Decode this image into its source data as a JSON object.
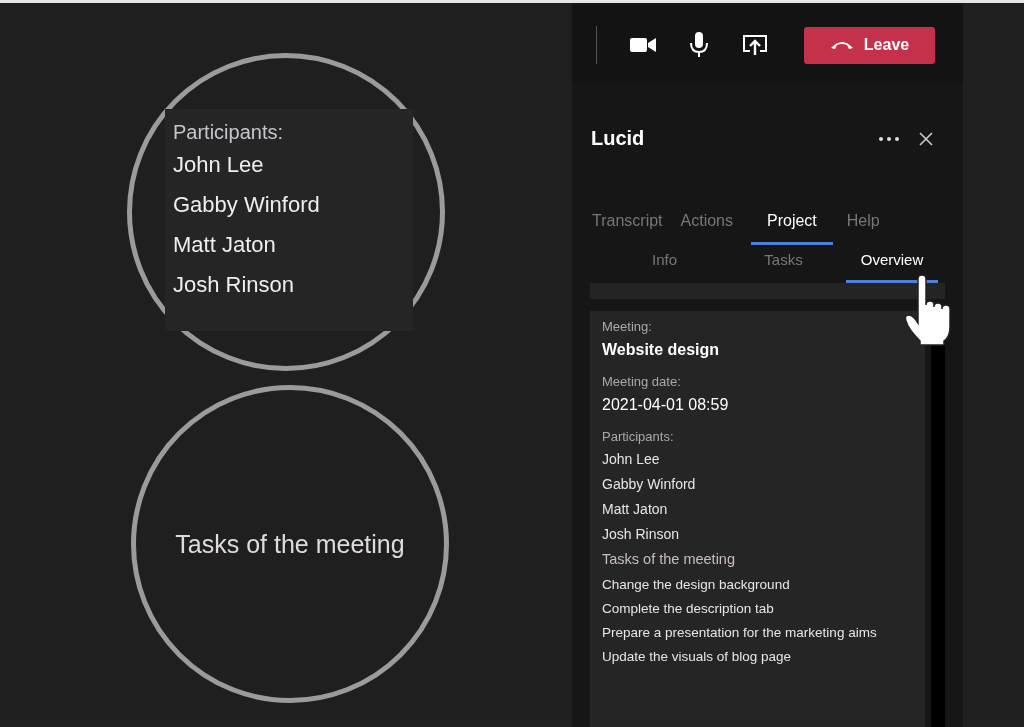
{
  "zoom_callouts": [
    {
      "kind": "list",
      "label": "Participants:",
      "items": [
        "John Lee",
        "Gabby Winford",
        "Matt Jaton",
        "Josh Rinson"
      ]
    },
    {
      "kind": "heading",
      "label": "Tasks of the meeting"
    }
  ],
  "call_bar": {
    "leave_button": "Leave"
  },
  "panel": {
    "title": "Lucid",
    "tabs": [
      {
        "label": "Transcript",
        "selected": false
      },
      {
        "label": "Actions",
        "selected": false
      },
      {
        "label": "Project",
        "selected": true
      },
      {
        "label": "Help",
        "selected": false
      }
    ],
    "subtabs": [
      {
        "label": "Info",
        "selected": false
      },
      {
        "label": "Tasks",
        "selected": false
      },
      {
        "label": "Overview",
        "selected": true
      }
    ],
    "overview": {
      "meeting_label": "Meeting:",
      "meeting": "Website design",
      "date_label": "Meeting date:",
      "date": "2021-04-01 08:59",
      "participants_label": "Participants:",
      "participants": [
        "John Lee",
        "Gabby Winford",
        "Matt Jaton",
        "Josh Rinson"
      ],
      "tasks_label": "Tasks of the meeting",
      "tasks": [
        "Change the design background",
        "Complete the description tab",
        "Prepare a presentation for the marketing aims",
        "Update the visuals of blog page"
      ]
    }
  }
}
